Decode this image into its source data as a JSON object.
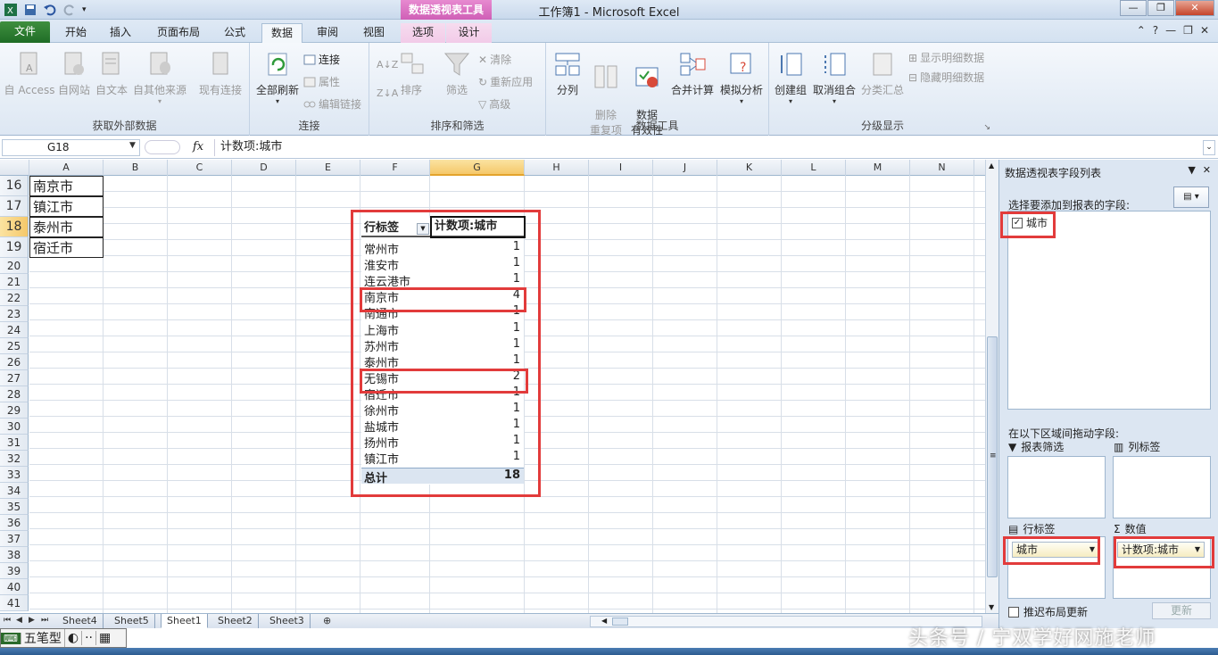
{
  "window": {
    "title": "工作簿1 - Microsoft Excel",
    "contextual_tab": "数据透视表工具"
  },
  "tabs": [
    "文件",
    "开始",
    "插入",
    "页面布局",
    "公式",
    "数据",
    "审阅",
    "视图",
    "选项",
    "设计"
  ],
  "ribbon": {
    "groups": {
      "external": {
        "label": "获取外部数据",
        "buttons": [
          "自 Access",
          "自网站",
          "自文本",
          "自其他来源",
          "现有连接"
        ]
      },
      "connections": {
        "label": "连接",
        "refresh_all": "全部刷新",
        "small": [
          "连接",
          "属性",
          "编辑链接"
        ]
      },
      "sort_filter": {
        "label": "排序和筛选",
        "sort": "排序",
        "filter": "筛选",
        "small": [
          "清除",
          "重新应用",
          "高级"
        ]
      },
      "data_tools": {
        "label": "数据工具",
        "buttons": [
          "分列",
          "删除\n重复项",
          "数据\n有效性",
          "合并计算",
          "模拟分析"
        ]
      },
      "outline": {
        "label": "分级显示",
        "buttons": [
          "创建组",
          "取消组合",
          "分类汇总"
        ],
        "small": [
          "显示明细数据",
          "隐藏明细数据"
        ]
      }
    }
  },
  "formula_bar": {
    "name_box": "G18",
    "fx": "fx",
    "formula": "计数项:城市"
  },
  "grid": {
    "columns": [
      "A",
      "B",
      "C",
      "D",
      "E",
      "F",
      "G",
      "H",
      "I",
      "J",
      "K",
      "L",
      "M",
      "N"
    ],
    "selected_column": "G",
    "rows": [
      "16",
      "17",
      "18",
      "19",
      "20",
      "21",
      "22",
      "23",
      "24",
      "25",
      "26",
      "27",
      "28",
      "29",
      "30",
      "31",
      "32",
      "33",
      "34",
      "35",
      "36",
      "37",
      "38",
      "39",
      "40",
      "41"
    ],
    "selected_row": "18",
    "col_a_values": [
      "南京市",
      "镇江市",
      "泰州市",
      "宿迁市"
    ]
  },
  "pivot": {
    "row_header": "行标签",
    "value_header": "计数项:城市",
    "rows": [
      {
        "label": "常州市",
        "value": "1"
      },
      {
        "label": "淮安市",
        "value": "1"
      },
      {
        "label": "连云港市",
        "value": "1"
      },
      {
        "label": "南京市",
        "value": "4"
      },
      {
        "label": "南通市",
        "value": "1"
      },
      {
        "label": "上海市",
        "value": "1"
      },
      {
        "label": "苏州市",
        "value": "1"
      },
      {
        "label": "泰州市",
        "value": "1"
      },
      {
        "label": "无锡市",
        "value": "2"
      },
      {
        "label": "宿迁市",
        "value": "1"
      },
      {
        "label": "徐州市",
        "value": "1"
      },
      {
        "label": "盐城市",
        "value": "1"
      },
      {
        "label": "扬州市",
        "value": "1"
      },
      {
        "label": "镇江市",
        "value": "1"
      }
    ],
    "total_label": "总计",
    "total_value": "18"
  },
  "sheets": [
    "Sheet4",
    "Sheet5",
    "Sheet1",
    "Sheet2",
    "Sheet3"
  ],
  "active_sheet": "Sheet1",
  "ime": {
    "mode": "五笔型"
  },
  "field_list": {
    "title": "数据透视表字段列表",
    "choose_label": "选择要添加到报表的字段:",
    "fields": [
      {
        "name": "城市",
        "checked": true
      }
    ],
    "drag_label": "在以下区域间拖动字段:",
    "areas": {
      "filter": "报表筛选",
      "columns": "列标签",
      "rows": "行标签",
      "values": "数值"
    },
    "row_item": "城市",
    "value_item": "计数项:城市",
    "defer_label": "推迟布局更新",
    "update_button": "更新"
  },
  "watermark": "头条号 / 宁双学好网施老师",
  "colors": {
    "highlight_red": "#e23b3b",
    "file_tab_green": "#1f6d26",
    "contextual_pink": "#cf5fb6"
  }
}
